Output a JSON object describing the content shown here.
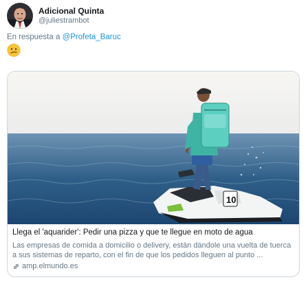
{
  "author": {
    "name": "Adicional Quinta",
    "handle": "@juliestrambot"
  },
  "reply": {
    "prefix": "En respuesta a ",
    "mention": "@Profeta_Baruc"
  },
  "tweet": {
    "emoji_icon": "confused-face-emoji"
  },
  "card": {
    "title": "Llega el 'aquarider': Pedir una pizza y que te llegue en moto de agua",
    "description": "Las empresas de comida a domicilio o delivery, están dándole una vuelta de tuerca a sus sistemas de reparto, con el fin de que los pedidos lleguen al punto ...",
    "domain": "amp.elmundo.es",
    "jetski_number": "10",
    "link_icon": "link-icon"
  },
  "colors": {
    "link": "#1b95e0",
    "secondary_text": "#657786",
    "border": "#ccd6dd",
    "courier_bag": "#5ccfc0"
  }
}
